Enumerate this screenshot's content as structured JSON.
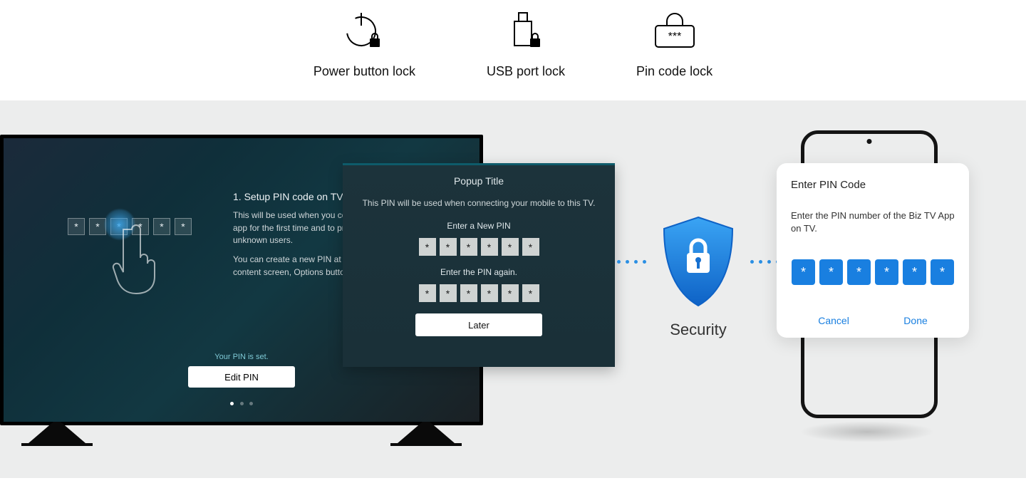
{
  "top": {
    "power": "Power button lock",
    "usb": "USB port lock",
    "pin": "Pin code lock"
  },
  "tv": {
    "title": "1. Setup PIN code on TV",
    "p1": "This will be used when you connect «Business TV» mobile app for the first time and to protect your TV from other unknown users.",
    "p2": "You can create a new PIN at Options. Press ENTER at content screen, Options button with the content.",
    "pin_set": "Your PIN is set.",
    "edit_btn": "Edit PIN",
    "pin_char": "*"
  },
  "popup": {
    "title": "Popup Title",
    "desc": "This PIN will be used when connecting your mobile to this TV.",
    "enter_new": "Enter a New PIN",
    "enter_again": "Enter the PIN again.",
    "later": "Later",
    "pin_char": "*"
  },
  "security": {
    "label": "Security"
  },
  "phone": {
    "title": "Enter PIN Code",
    "desc": "Enter the PIN number of the Biz TV App on TV.",
    "cancel": "Cancel",
    "done": "Done",
    "pin_char": "*"
  }
}
